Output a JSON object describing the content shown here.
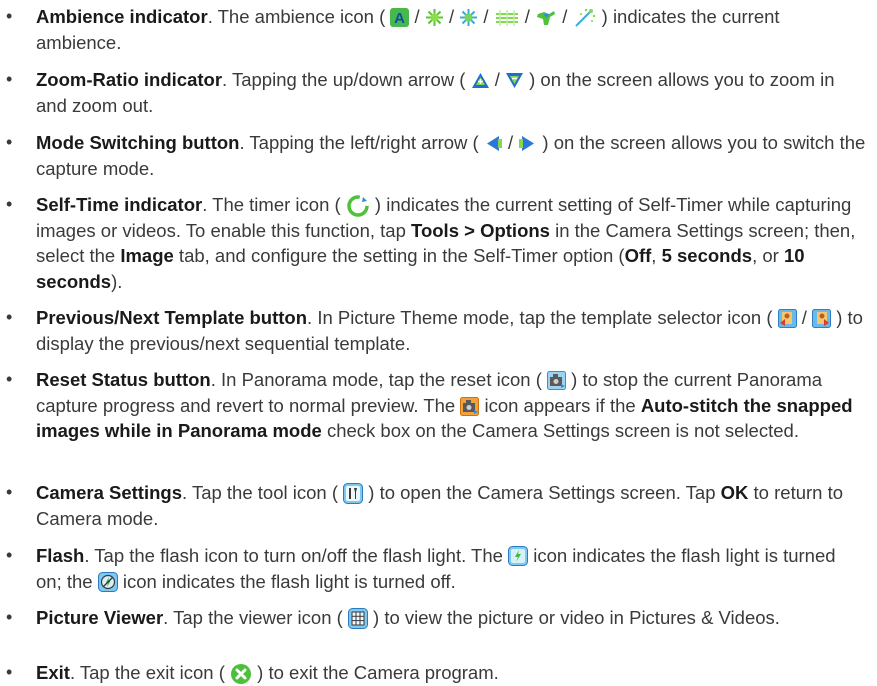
{
  "items": [
    {
      "title": "Ambience indicator",
      "parts": [
        ". The ambience icon ( ",
        " / ",
        " / ",
        " / ",
        " / ",
        " / ",
        " ) indicates the current ambience."
      ],
      "icons": [
        "ambience-auto-icon",
        "ambience-sunny-icon",
        "ambience-bright-icon",
        "ambience-fluorescent-icon",
        "ambience-incandescent-icon",
        "ambience-night-icon"
      ]
    },
    {
      "title": "Zoom-Ratio indicator",
      "parts": [
        ". Tapping the up/down arrow ( ",
        " / ",
        " ) on the screen allows you to zoom in and zoom out."
      ],
      "icons": [
        "zoom-up-arrow-icon",
        "zoom-down-arrow-icon"
      ]
    },
    {
      "title": "Mode Switching button",
      "parts": [
        ". Tapping the left/right arrow ( ",
        " / ",
        " ) on the screen allows you to switch the capture mode."
      ],
      "icons": [
        "left-arrow-icon",
        "right-arrow-icon"
      ]
    },
    {
      "title": "Self-Time indicator",
      "parts": [
        ". The timer icon ( ",
        " ) indicates the current setting of Self-Timer while capturing images or videos. To enable this function, tap "
      ],
      "bold1": "Tools > Options",
      "parts2": [
        " in the Camera Settings screen; then, select the "
      ],
      "bold2": "Image",
      "parts3": [
        " tab, and configure the setting in the Self-Timer option ("
      ],
      "opt1": "Off",
      "sep1": ", ",
      "opt2": "5 seconds",
      "sep2": ", or ",
      "opt3": "10 seconds",
      "end": ").",
      "icons": [
        "timer-icon"
      ]
    },
    {
      "title": "Previous/Next Template button",
      "parts": [
        ". In Picture Theme mode, tap the template selector icon ( ",
        " / ",
        " ) to display the previous/next sequential template."
      ],
      "icons": [
        "template-previous-icon",
        "template-next-icon"
      ]
    },
    {
      "title": "Reset Status button",
      "parts": [
        ". In Panorama mode, tap the reset icon ( ",
        " ) to stop the current Panorama capture progress and revert to normal preview. The ",
        " icon appears if the "
      ],
      "bold1": "Auto-stitch the snapped images while in Panorama mode",
      "end": " check box on the Camera Settings screen is not selected.",
      "icons": [
        "panorama-reset-icon",
        "panorama-stitch-icon"
      ]
    },
    {
      "title": "Camera Settings",
      "parts": [
        ". Tap the tool icon ( ",
        " ) to open the Camera Settings screen. Tap "
      ],
      "bold1": "OK",
      "end": " to return to Camera mode.",
      "icons": [
        "tool-icon"
      ]
    },
    {
      "title": "Flash",
      "parts": [
        ". Tap the flash icon to turn on/off the flash light. The ",
        " icon indicates the flash light is turned on; the ",
        " icon indicates the flash light is turned off."
      ],
      "icons": [
        "flash-on-icon",
        "flash-off-icon"
      ]
    },
    {
      "title": "Picture Viewer",
      "parts": [
        ". Tap the viewer icon ( ",
        " ) to view the picture or video in Pictures & Videos."
      ],
      "icons": [
        "viewer-icon"
      ]
    },
    {
      "title": "Exit",
      "parts": [
        ". Tap the exit icon ( ",
        " ) to exit the Camera program."
      ],
      "icons": [
        "exit-icon"
      ]
    }
  ],
  "bullet": "•"
}
